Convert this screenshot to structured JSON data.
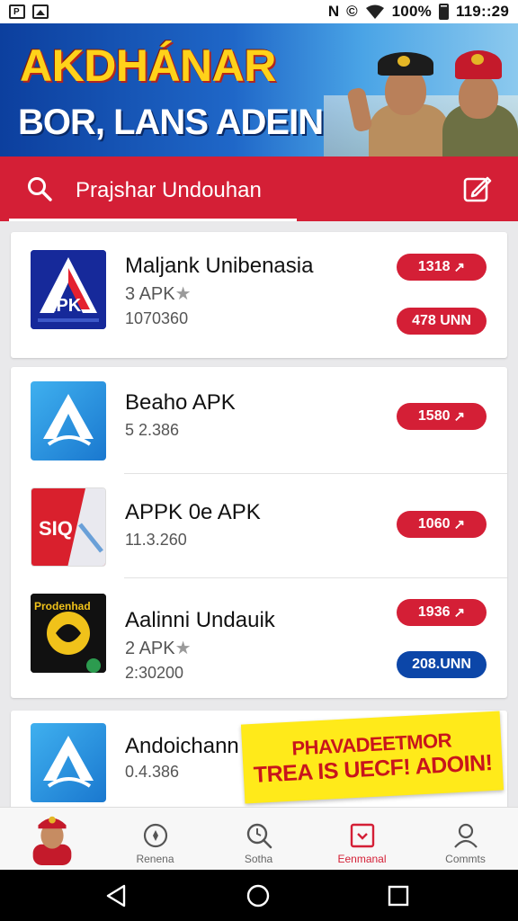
{
  "status_bar": {
    "battery_percent": "100%",
    "time": "119::29",
    "nfc_glyph": "N",
    "data_glyph": "©"
  },
  "banner": {
    "title": "AKDHÁNAR",
    "subtitle": "BOR, LANS ADEIN"
  },
  "search": {
    "text": "Prajshar Undouhan"
  },
  "apps": [
    {
      "title": "Maljank Unibenasia",
      "meta": "3 APK",
      "meta_star": "★",
      "meta2": "1070360",
      "buttons": [
        {
          "label": "1318 ",
          "arrow": "↗",
          "color": "red"
        },
        {
          "label": "478 UNN",
          "color": "red"
        }
      ]
    },
    {
      "title": "Beaho APK",
      "meta": "5 2.386",
      "buttons": [
        {
          "label": "1580 ",
          "arrow": "↗",
          "color": "red"
        }
      ]
    },
    {
      "title": "APPK 0e APK",
      "meta": "11.3.260",
      "buttons": [
        {
          "label": "1060 ",
          "arrow": "↗",
          "color": "red"
        }
      ]
    },
    {
      "title": "Aalinni Undauik",
      "meta": "2 APK",
      "meta_star": "★",
      "meta2": "2:30200",
      "buttons": [
        {
          "label": "1936 ",
          "arrow": "↗",
          "color": "red"
        },
        {
          "label": "208.UNN",
          "color": "blue"
        }
      ]
    },
    {
      "title": "Andoichann",
      "meta": "0.4.386"
    }
  ],
  "app_icon_text": {
    "icon1": "APK",
    "icon3": "SIQ",
    "icon4": "Prodenhad"
  },
  "promo": {
    "line1": "PHAVADEETMOR",
    "line2": "TREA IS UECF! ADOIN!"
  },
  "bottom_nav": [
    {
      "label": "",
      "icon": "avatar-icon"
    },
    {
      "label": "Renena",
      "icon": "compass-icon"
    },
    {
      "label": "Sotha",
      "icon": "search-icon"
    },
    {
      "label": "Eenmanal",
      "icon": "download-box-icon",
      "active": true
    },
    {
      "label": "Commts",
      "icon": "person-icon"
    }
  ],
  "colors": {
    "brand_red": "#d41f36",
    "brand_blue": "#0c46a8",
    "promo_yellow": "#ffea1a"
  }
}
